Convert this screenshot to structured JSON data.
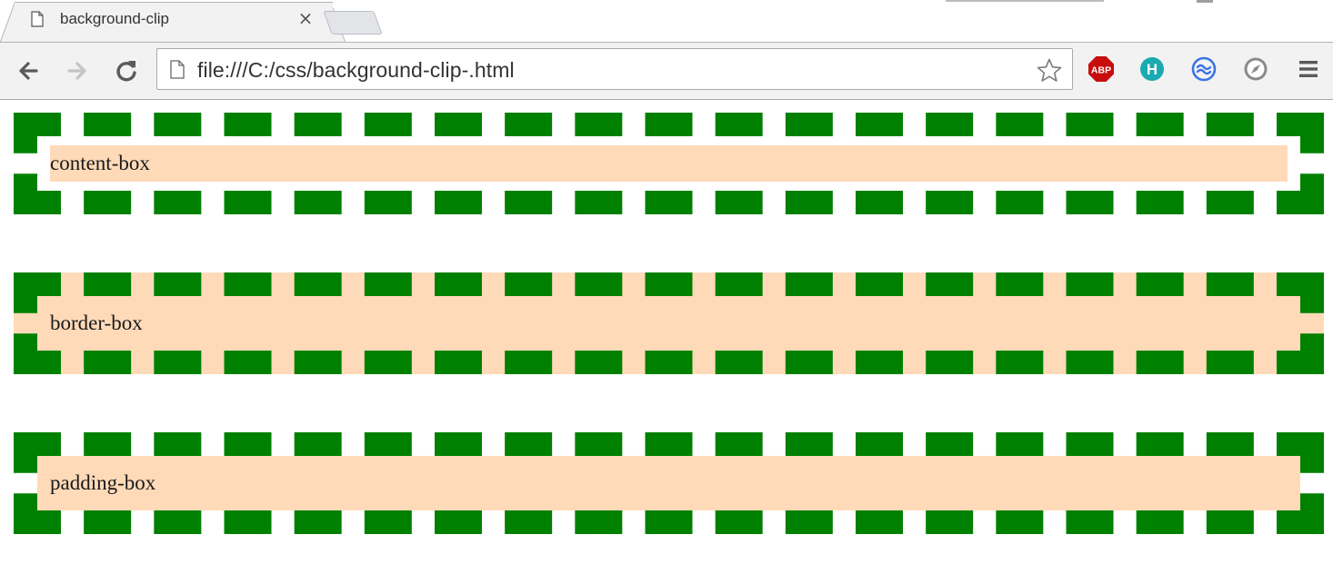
{
  "tab": {
    "title": "background-clip",
    "close_glyph": "×"
  },
  "omnibox": {
    "url": "file:///C:/css/background-clip-.html"
  },
  "toolbar": {
    "icons": [
      "back-arrow-icon",
      "forward-arrow-icon",
      "reload-icon",
      "page-icon",
      "star-icon",
      "abp-icon",
      "h-extension-icon",
      "sync-icon",
      "compass-icon",
      "menu-icon"
    ],
    "abp_label": "ABP",
    "h_label": "H"
  },
  "page": {
    "boxes": [
      {
        "label": "content-box"
      },
      {
        "label": "border-box"
      },
      {
        "label": "padding-box"
      }
    ]
  },
  "colors": {
    "border": "#008000",
    "background": "#ffdab9",
    "abp": "#c70d0d",
    "h_ext": "#1aaab1",
    "sync": "#3a73e6"
  }
}
